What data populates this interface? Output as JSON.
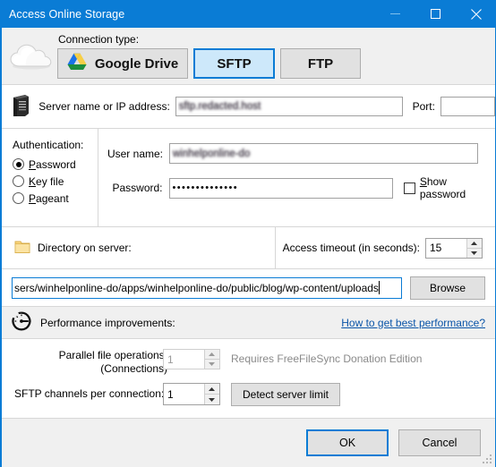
{
  "window": {
    "title": "Access Online Storage",
    "minimize_label": "Minimize",
    "maximize_label": "Maximize",
    "close_label": "Close",
    "accent_color": "#0a7cd5"
  },
  "connection": {
    "label": "Connection type:",
    "options": [
      {
        "id": "google-drive",
        "label": "Google Drive",
        "selected": false
      },
      {
        "id": "sftp",
        "label": "SFTP",
        "selected": true
      },
      {
        "id": "ftp",
        "label": "FTP",
        "selected": false
      }
    ]
  },
  "server": {
    "label": "Server name or IP address:",
    "value": "sftp.redacted.host",
    "value_redacted": true,
    "port_label": "Port:",
    "port_value": ""
  },
  "authentication": {
    "title": "Authentication:",
    "options": [
      {
        "id": "password",
        "label": "Password",
        "accel": "P",
        "selected": true
      },
      {
        "id": "key-file",
        "label": "Key file",
        "accel": "K",
        "selected": false
      },
      {
        "id": "pageant",
        "label": "Pageant",
        "accel": "P",
        "selected": false
      }
    ],
    "username_label": "User name:",
    "username_value": "winhelponline-do",
    "username_redacted": true,
    "password_label": "Password:",
    "password_mask": "••••••••••••••",
    "show_password_label": "Show password",
    "show_password_accel": "S",
    "show_password_checked": false
  },
  "directory": {
    "label": "Directory on server:",
    "path_value": "sers/winhelponline-do/apps/winhelponline-do/public/blog/wp-content/uploads",
    "browse_label": "Browse"
  },
  "timeout": {
    "label": "Access timeout (in seconds):",
    "value": "15"
  },
  "performance": {
    "title": "Performance improvements:",
    "link_label": "How to get best performance?",
    "parallel_label_line1": "Parallel file operations:",
    "parallel_label_line2": "(Connections)",
    "parallel_value": "1",
    "parallel_disabled": true,
    "donation_note": "Requires FreeFileSync Donation Edition",
    "channels_label": "SFTP channels per connection:",
    "channels_value": "1",
    "detect_label": "Detect server limit"
  },
  "footer": {
    "ok_label": "OK",
    "cancel_label": "Cancel"
  }
}
